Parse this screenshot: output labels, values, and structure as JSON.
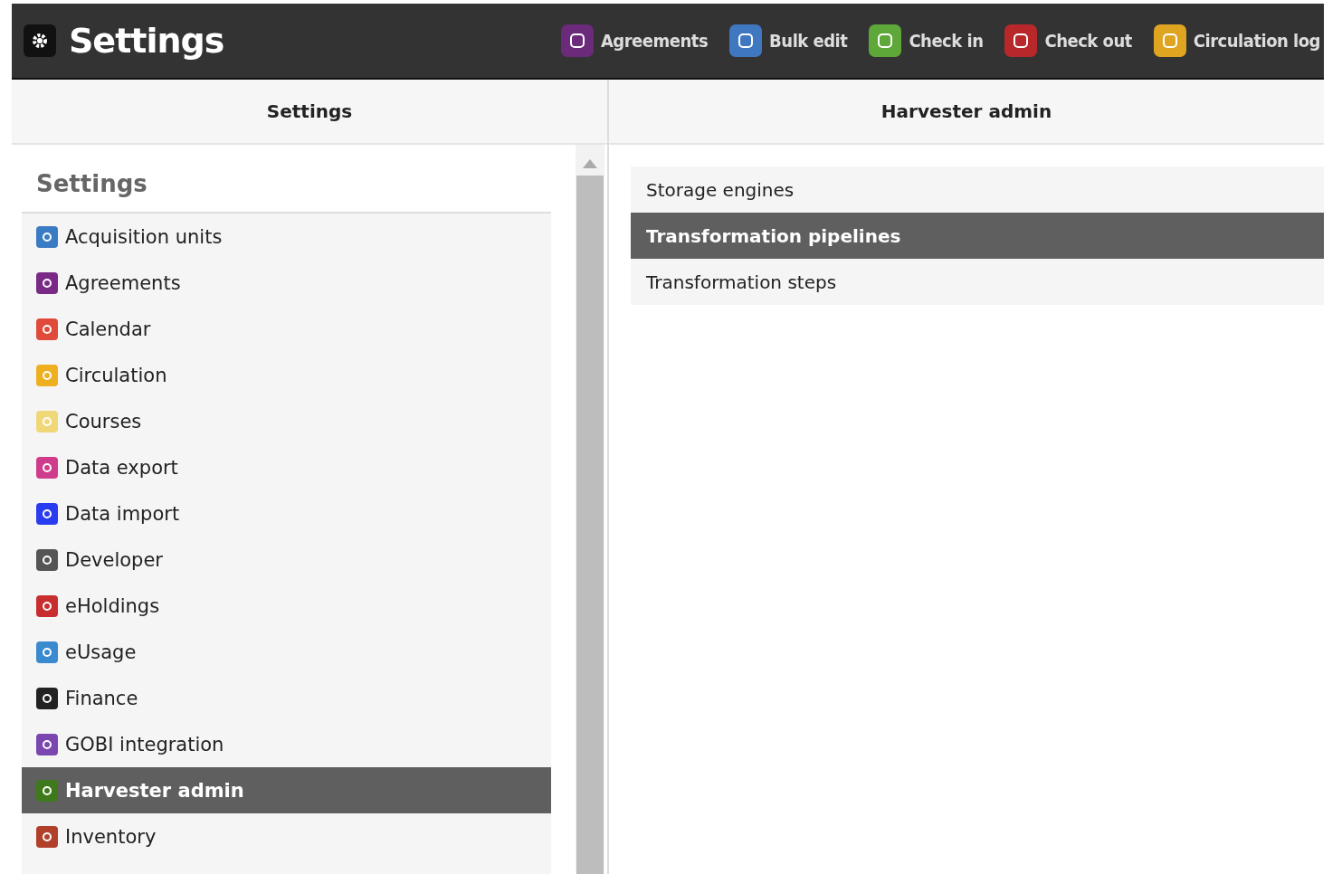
{
  "topbar": {
    "title": "Settings",
    "apps": [
      {
        "label": "Agreements",
        "color": "#6b2a7a"
      },
      {
        "label": "Bulk edit",
        "color": "#3f78c0"
      },
      {
        "label": "Check in",
        "color": "#5ea83a"
      },
      {
        "label": "Check out",
        "color": "#b8282a"
      },
      {
        "label": "Circulation log",
        "color": "#e0a520"
      }
    ]
  },
  "left_pane": {
    "header": "Settings",
    "heading": "Settings",
    "items": [
      {
        "label": "Acquisition units",
        "color": "#3a7cc4",
        "selected": false
      },
      {
        "label": "Agreements",
        "color": "#7a2a86",
        "selected": false
      },
      {
        "label": "Calendar",
        "color": "#e04a3a",
        "selected": false
      },
      {
        "label": "Circulation",
        "color": "#eeb020",
        "selected": false
      },
      {
        "label": "Courses",
        "color": "#f0d878",
        "selected": false
      },
      {
        "label": "Data export",
        "color": "#d03c8c",
        "selected": false
      },
      {
        "label": "Data import",
        "color": "#2a3cf0",
        "selected": false
      },
      {
        "label": "Developer",
        "color": "#555555",
        "selected": false
      },
      {
        "label": "eHoldings",
        "color": "#c82e30",
        "selected": false
      },
      {
        "label": "eUsage",
        "color": "#3a8ad0",
        "selected": false
      },
      {
        "label": "Finance",
        "color": "#222222",
        "selected": false
      },
      {
        "label": "GOBI integration",
        "color": "#7a46b0",
        "selected": false
      },
      {
        "label": "Harvester admin",
        "color": "#3e7a1c",
        "selected": true
      },
      {
        "label": "Inventory",
        "color": "#b0402a",
        "selected": false
      }
    ]
  },
  "right_pane": {
    "header": "Harvester admin",
    "items": [
      {
        "label": "Storage engines",
        "selected": false
      },
      {
        "label": "Transformation pipelines",
        "selected": true
      },
      {
        "label": "Transformation steps",
        "selected": false
      }
    ]
  }
}
